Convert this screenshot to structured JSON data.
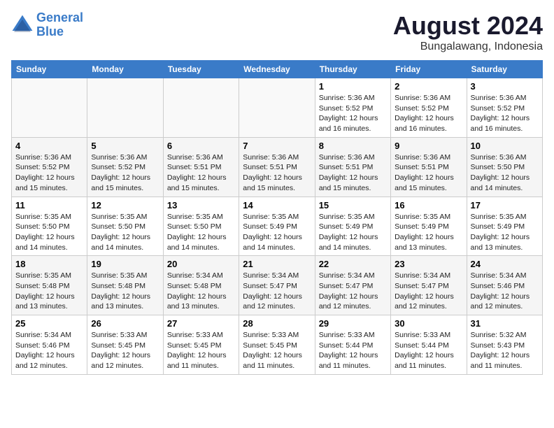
{
  "header": {
    "logo_line1": "General",
    "logo_line2": "Blue",
    "title": "August 2024",
    "subtitle": "Bungalawang, Indonesia"
  },
  "weekdays": [
    "Sunday",
    "Monday",
    "Tuesday",
    "Wednesday",
    "Thursday",
    "Friday",
    "Saturday"
  ],
  "weeks": [
    [
      {
        "day": "",
        "info": ""
      },
      {
        "day": "",
        "info": ""
      },
      {
        "day": "",
        "info": ""
      },
      {
        "day": "",
        "info": ""
      },
      {
        "day": "1",
        "info": "Sunrise: 5:36 AM\nSunset: 5:52 PM\nDaylight: 12 hours\nand 16 minutes."
      },
      {
        "day": "2",
        "info": "Sunrise: 5:36 AM\nSunset: 5:52 PM\nDaylight: 12 hours\nand 16 minutes."
      },
      {
        "day": "3",
        "info": "Sunrise: 5:36 AM\nSunset: 5:52 PM\nDaylight: 12 hours\nand 16 minutes."
      }
    ],
    [
      {
        "day": "4",
        "info": "Sunrise: 5:36 AM\nSunset: 5:52 PM\nDaylight: 12 hours\nand 15 minutes."
      },
      {
        "day": "5",
        "info": "Sunrise: 5:36 AM\nSunset: 5:52 PM\nDaylight: 12 hours\nand 15 minutes."
      },
      {
        "day": "6",
        "info": "Sunrise: 5:36 AM\nSunset: 5:51 PM\nDaylight: 12 hours\nand 15 minutes."
      },
      {
        "day": "7",
        "info": "Sunrise: 5:36 AM\nSunset: 5:51 PM\nDaylight: 12 hours\nand 15 minutes."
      },
      {
        "day": "8",
        "info": "Sunrise: 5:36 AM\nSunset: 5:51 PM\nDaylight: 12 hours\nand 15 minutes."
      },
      {
        "day": "9",
        "info": "Sunrise: 5:36 AM\nSunset: 5:51 PM\nDaylight: 12 hours\nand 15 minutes."
      },
      {
        "day": "10",
        "info": "Sunrise: 5:36 AM\nSunset: 5:50 PM\nDaylight: 12 hours\nand 14 minutes."
      }
    ],
    [
      {
        "day": "11",
        "info": "Sunrise: 5:35 AM\nSunset: 5:50 PM\nDaylight: 12 hours\nand 14 minutes."
      },
      {
        "day": "12",
        "info": "Sunrise: 5:35 AM\nSunset: 5:50 PM\nDaylight: 12 hours\nand 14 minutes."
      },
      {
        "day": "13",
        "info": "Sunrise: 5:35 AM\nSunset: 5:50 PM\nDaylight: 12 hours\nand 14 minutes."
      },
      {
        "day": "14",
        "info": "Sunrise: 5:35 AM\nSunset: 5:49 PM\nDaylight: 12 hours\nand 14 minutes."
      },
      {
        "day": "15",
        "info": "Sunrise: 5:35 AM\nSunset: 5:49 PM\nDaylight: 12 hours\nand 14 minutes."
      },
      {
        "day": "16",
        "info": "Sunrise: 5:35 AM\nSunset: 5:49 PM\nDaylight: 12 hours\nand 13 minutes."
      },
      {
        "day": "17",
        "info": "Sunrise: 5:35 AM\nSunset: 5:49 PM\nDaylight: 12 hours\nand 13 minutes."
      }
    ],
    [
      {
        "day": "18",
        "info": "Sunrise: 5:35 AM\nSunset: 5:48 PM\nDaylight: 12 hours\nand 13 minutes."
      },
      {
        "day": "19",
        "info": "Sunrise: 5:35 AM\nSunset: 5:48 PM\nDaylight: 12 hours\nand 13 minutes."
      },
      {
        "day": "20",
        "info": "Sunrise: 5:34 AM\nSunset: 5:48 PM\nDaylight: 12 hours\nand 13 minutes."
      },
      {
        "day": "21",
        "info": "Sunrise: 5:34 AM\nSunset: 5:47 PM\nDaylight: 12 hours\nand 12 minutes."
      },
      {
        "day": "22",
        "info": "Sunrise: 5:34 AM\nSunset: 5:47 PM\nDaylight: 12 hours\nand 12 minutes."
      },
      {
        "day": "23",
        "info": "Sunrise: 5:34 AM\nSunset: 5:47 PM\nDaylight: 12 hours\nand 12 minutes."
      },
      {
        "day": "24",
        "info": "Sunrise: 5:34 AM\nSunset: 5:46 PM\nDaylight: 12 hours\nand 12 minutes."
      }
    ],
    [
      {
        "day": "25",
        "info": "Sunrise: 5:34 AM\nSunset: 5:46 PM\nDaylight: 12 hours\nand 12 minutes."
      },
      {
        "day": "26",
        "info": "Sunrise: 5:33 AM\nSunset: 5:45 PM\nDaylight: 12 hours\nand 12 minutes."
      },
      {
        "day": "27",
        "info": "Sunrise: 5:33 AM\nSunset: 5:45 PM\nDaylight: 12 hours\nand 11 minutes."
      },
      {
        "day": "28",
        "info": "Sunrise: 5:33 AM\nSunset: 5:45 PM\nDaylight: 12 hours\nand 11 minutes."
      },
      {
        "day": "29",
        "info": "Sunrise: 5:33 AM\nSunset: 5:44 PM\nDaylight: 12 hours\nand 11 minutes."
      },
      {
        "day": "30",
        "info": "Sunrise: 5:33 AM\nSunset: 5:44 PM\nDaylight: 12 hours\nand 11 minutes."
      },
      {
        "day": "31",
        "info": "Sunrise: 5:32 AM\nSunset: 5:43 PM\nDaylight: 12 hours\nand 11 minutes."
      }
    ]
  ]
}
